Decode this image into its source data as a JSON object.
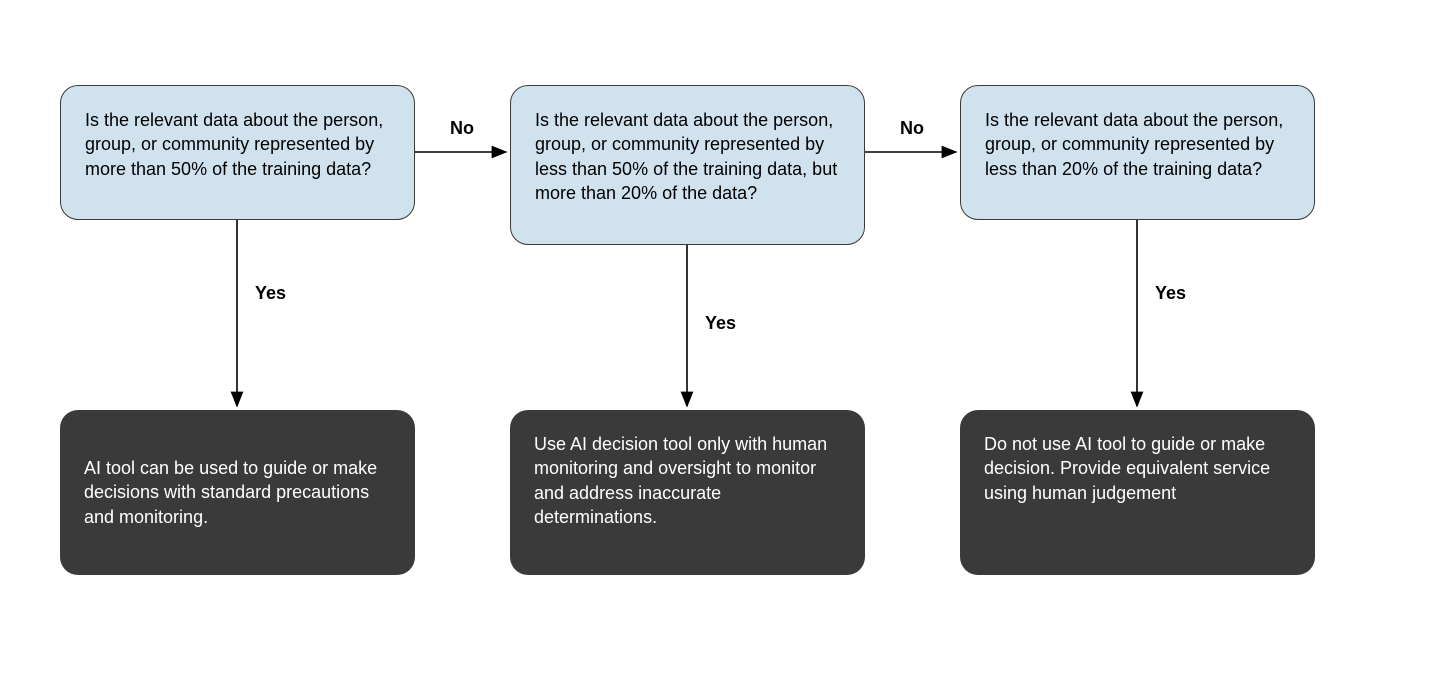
{
  "chart_data": {
    "type": "flowchart",
    "nodes": [
      {
        "id": "q1",
        "kind": "decision",
        "text": "Is the relevant data about the person, group, or community represented by more than 50% of the training data?"
      },
      {
        "id": "q2",
        "kind": "decision",
        "text": "Is the relevant data about the person, group, or community represented by less than 50% of the training data, but more than 20% of the data?"
      },
      {
        "id": "q3",
        "kind": "decision",
        "text": "Is the relevant data about the person, group, or community represented by less than 20% of the training data?"
      },
      {
        "id": "o1",
        "kind": "outcome",
        "text": "AI tool can be used to guide or make decisions with standard precautions and monitoring."
      },
      {
        "id": "o2",
        "kind": "outcome",
        "text": "Use AI decision tool only with human monitoring and oversight to monitor and address inaccurate determinations."
      },
      {
        "id": "o3",
        "kind": "outcome",
        "text": "Do not use AI tool to guide or make decision. Provide equivalent service using human judgement"
      }
    ],
    "edges": [
      {
        "from": "q1",
        "to": "q2",
        "label": "No"
      },
      {
        "from": "q2",
        "to": "q3",
        "label": "No"
      },
      {
        "from": "q1",
        "to": "o1",
        "label": "Yes"
      },
      {
        "from": "q2",
        "to": "o2",
        "label": "Yes"
      },
      {
        "from": "q3",
        "to": "o3",
        "label": "Yes"
      }
    ]
  },
  "labels": {
    "q1q2": "No",
    "q2q3": "No",
    "q1o1": "Yes",
    "q2o2": "Yes",
    "q3o3": "Yes"
  }
}
